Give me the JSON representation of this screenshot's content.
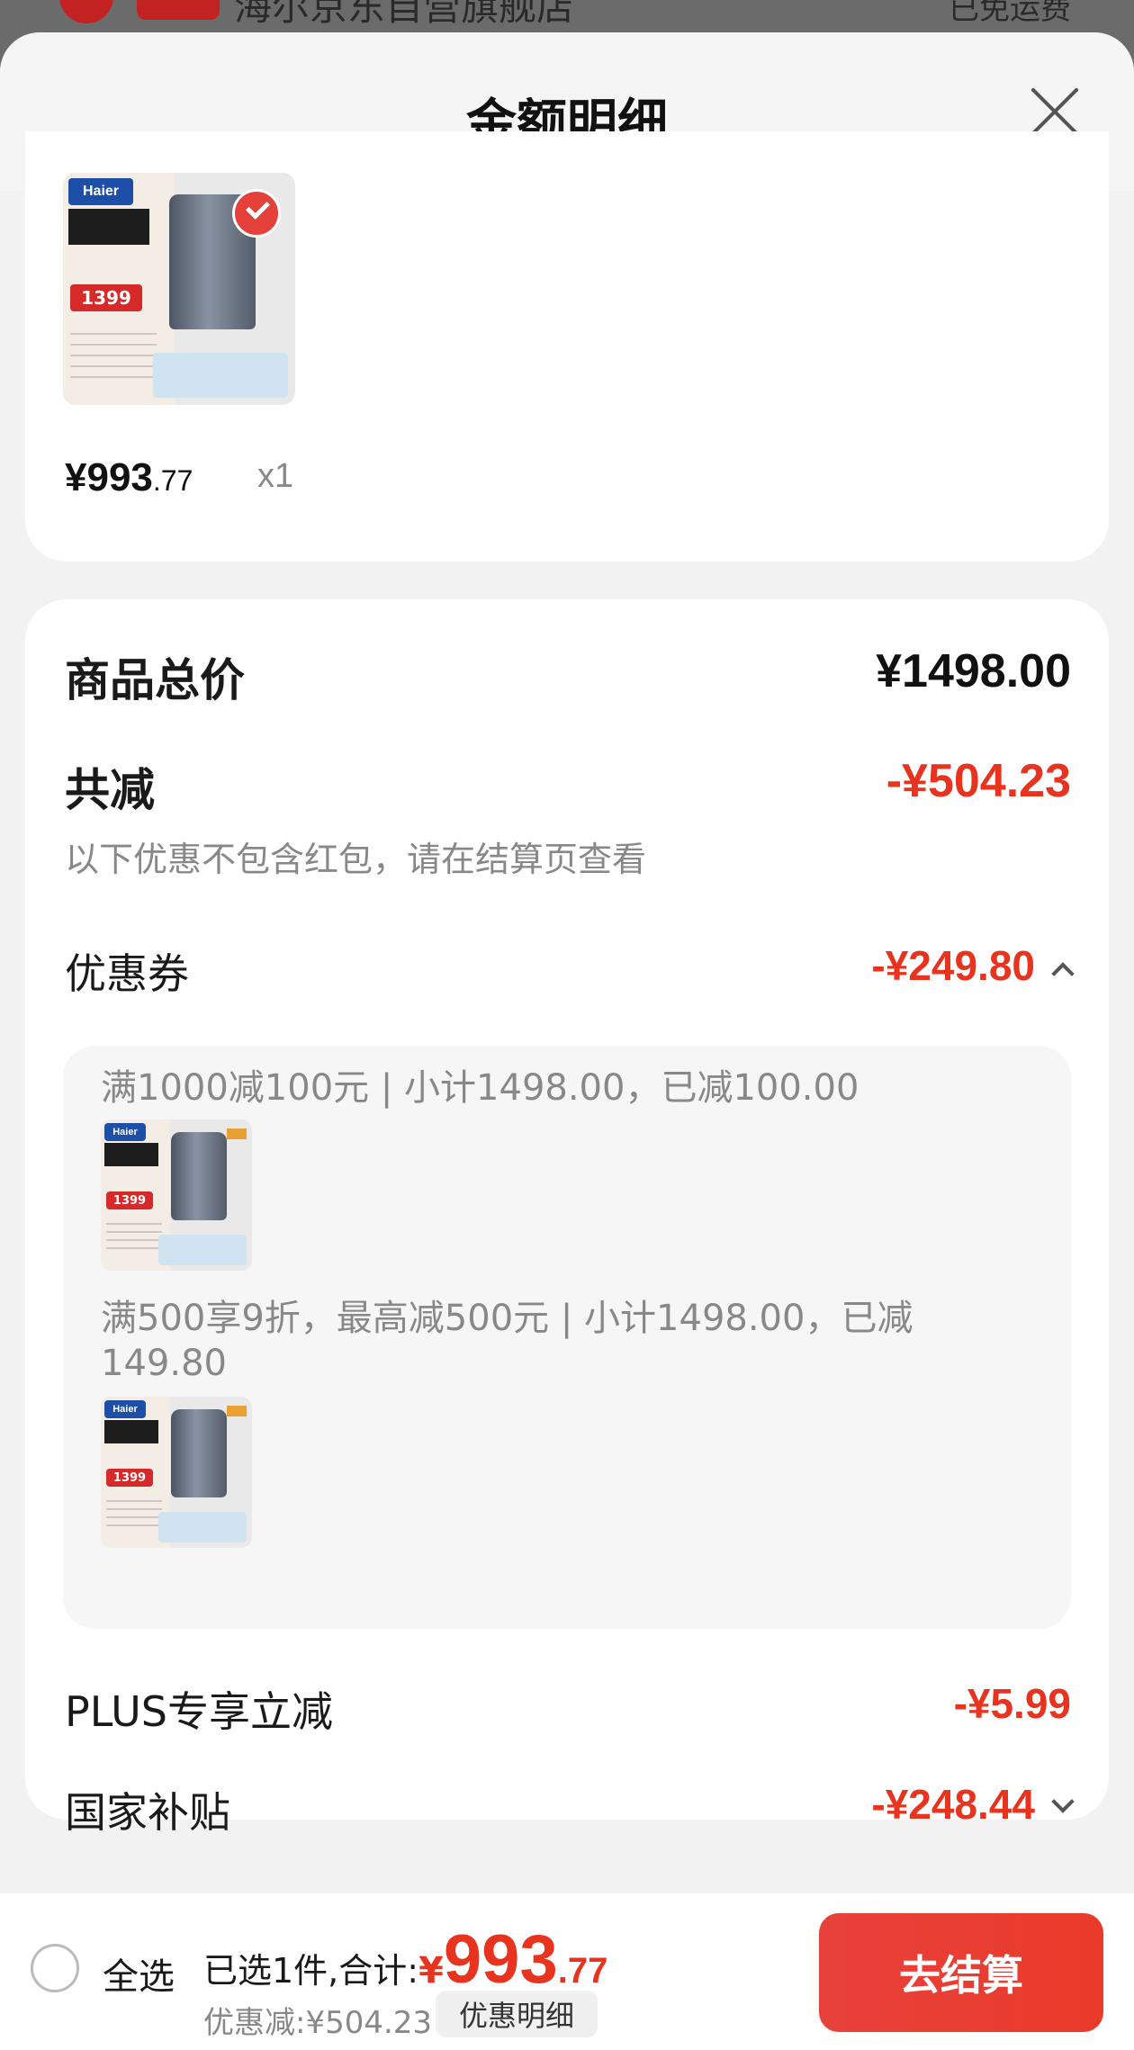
{
  "store": {
    "name": "海尔京东自营旗舰店",
    "shipping": "已免运费"
  },
  "sheet": {
    "title": "金额明细"
  },
  "product": {
    "price_main": "¥993",
    "price_decimal": ".77",
    "quantity": "x1",
    "thumb_brand": "Haier",
    "thumb_price": "1399"
  },
  "summary": {
    "total_label": "商品总价",
    "total_value": "¥1498.00",
    "reduction_label": "共减",
    "reduction_value": "-¥504.23",
    "reduction_note": "以下优惠不包含红包，请在结算页查看",
    "coupon_label": "优惠券",
    "coupon_value": "-¥249.80",
    "coupon_details": [
      "满1000减100元 | 小计1498.00，已减100.00",
      "满500享9折，最高减500元 | 小计1498.00，已减149.80"
    ],
    "plus_label": "PLUS专享立减",
    "plus_value": "-¥5.99",
    "subsidy_label": "国家补贴",
    "subsidy_value": "-¥248.44"
  },
  "footer": {
    "select_all": "全选",
    "selected_total_label": "已选1件,合计:",
    "currency": "¥",
    "total_int": "993",
    "total_dec": ".77",
    "saved": "优惠减:¥504.23",
    "detail_button": "优惠明细",
    "checkout_button": "去结算"
  },
  "colors": {
    "accent_red": "#e8331f",
    "checkout_red": "#e8413b"
  }
}
